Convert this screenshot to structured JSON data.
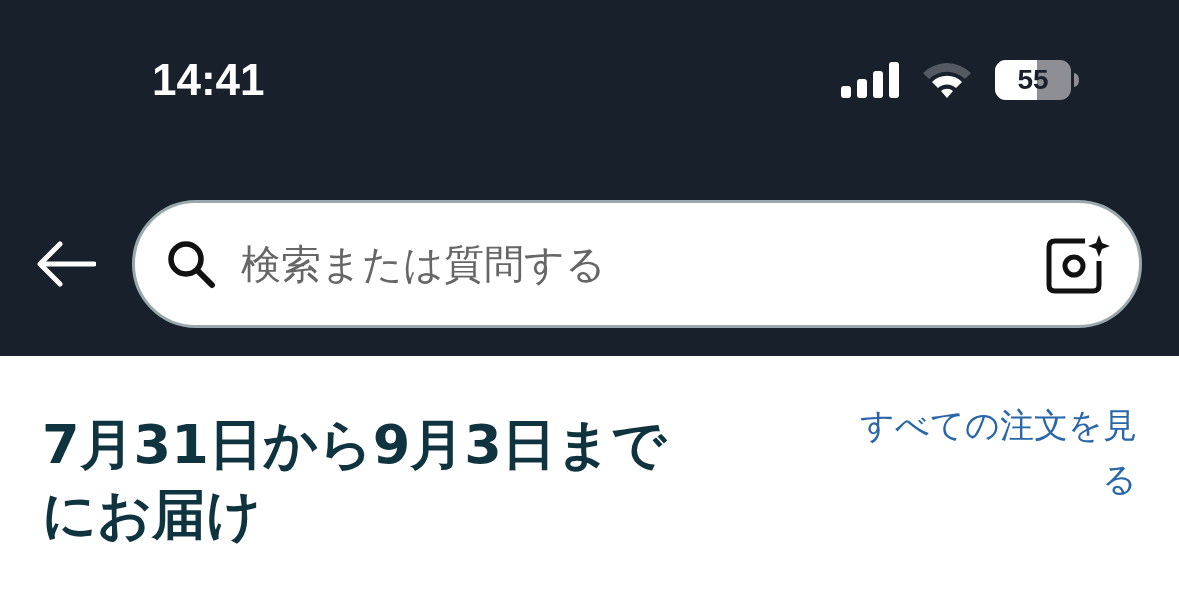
{
  "status_bar": {
    "time": "14:41",
    "battery_text": "55"
  },
  "search": {
    "placeholder": "検索または質問する"
  },
  "delivery": {
    "heading": "7月31日から9月3日までにお届け",
    "link": "すべての注文を見る"
  }
}
